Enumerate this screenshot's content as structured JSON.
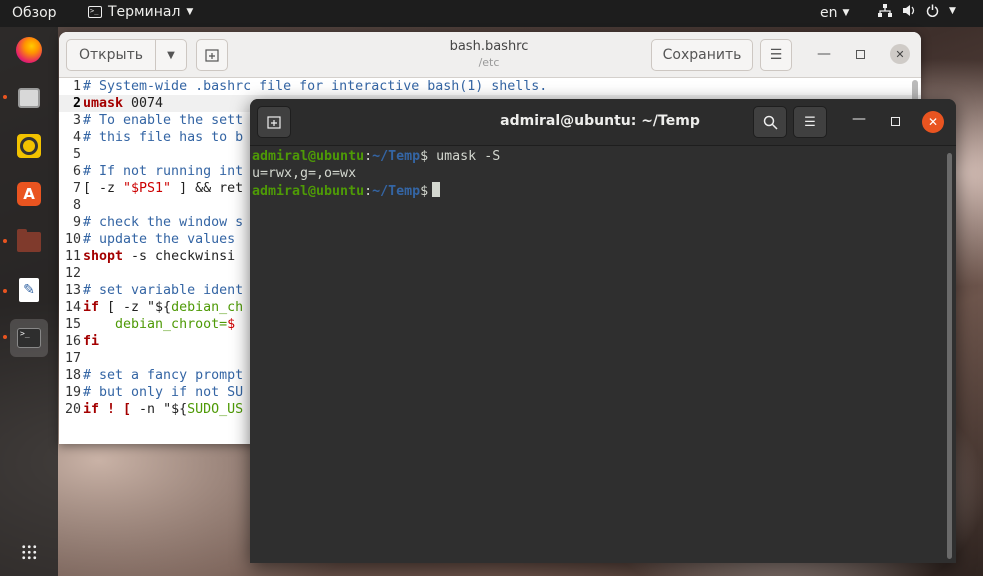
{
  "topbar": {
    "activities": "Обзор",
    "app_name": "Терминал",
    "lang": "en"
  },
  "dock": {
    "items": [
      "firefox-icon",
      "files-icon",
      "rhythmbox-icon",
      "software-icon",
      "folder-icon",
      "text-editor-icon",
      "terminal-icon",
      "show-apps-icon"
    ]
  },
  "gedit": {
    "open_label": "Открыть",
    "title": "bash.bashrc",
    "subtitle": "/etc",
    "save_label": "Сохранить",
    "lines": [
      {
        "n": "1",
        "text": "# System-wide .bashrc file for interactive bash(1) shells."
      },
      {
        "n": "2",
        "kw": "umask",
        "text": " 0074"
      },
      {
        "n": "3",
        "text": "# To enable the sett"
      },
      {
        "n": "4",
        "text": "# this file has to b"
      },
      {
        "n": "5",
        "text": ""
      },
      {
        "n": "6",
        "text": "# If not running int"
      },
      {
        "n": "7",
        "a": "[ -z ",
        "s": "\"$PS1\"",
        "b": " ] && ret"
      },
      {
        "n": "8",
        "text": ""
      },
      {
        "n": "9",
        "text": "# check the window s"
      },
      {
        "n": "10",
        "text": "# update the values"
      },
      {
        "n": "11",
        "kw": "shopt",
        "text": " -s checkwinsi"
      },
      {
        "n": "12",
        "text": ""
      },
      {
        "n": "13",
        "text": "# set variable ident"
      },
      {
        "n": "14",
        "kw": "if",
        "a": " [ -z \"${",
        "v": "debian_ch",
        "b": ""
      },
      {
        "n": "15",
        "v": "    debian_chroot=",
        "b": "$"
      },
      {
        "n": "16",
        "kw": "fi",
        "text": ""
      },
      {
        "n": "17",
        "text": ""
      },
      {
        "n": "18",
        "text": "# set a fancy prompt"
      },
      {
        "n": "19",
        "text": "# but only if not SU"
      },
      {
        "n": "20",
        "kw": "if ! [",
        "a": " -n \"${",
        "v": "SUDO_US",
        "b": ""
      }
    ]
  },
  "terminal": {
    "title": "admiral@ubuntu: ~/Temp",
    "prompt_user": "admiral@ubuntu",
    "prompt_sep": ":",
    "prompt_path": "~/Temp",
    "prompt_dollar": "$",
    "command1": " umask -S",
    "output1": "u=rwx,g=,o=wx"
  }
}
